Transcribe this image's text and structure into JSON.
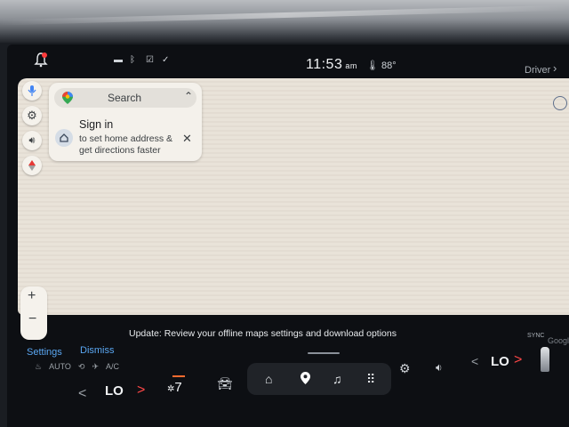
{
  "status_bar": {
    "time": "11:53",
    "ampm": "am",
    "temperature": "88",
    "temp_unit": "°",
    "driver_label": "Driver",
    "icons": [
      "notification-bell-icon",
      "message-icon",
      "bluetooth-icon",
      "checkbox-icon",
      "check-circle-icon"
    ]
  },
  "map": {
    "search_label": "Search",
    "signin_title": "Sign in",
    "signin_subtitle": "to set home address & get directions faster",
    "zoom_in": "+",
    "zoom_out": "−",
    "attribution": "Google",
    "side_buttons": [
      "mic-icon",
      "settings-icon",
      "volume-icon",
      "compass-icon"
    ]
  },
  "notification": {
    "settings_label": "Settings",
    "dismiss_label": "Dismiss",
    "message": "Update: Review your offline maps settings and download options",
    "sync_label": "SYNC"
  },
  "climate": {
    "auto_label": "AUTO",
    "ac_label": "A/C",
    "left_temp": "LO",
    "fan_speed": "7",
    "right_temp": "LO"
  },
  "dock": {
    "icons": [
      "home-icon",
      "map-pin-icon",
      "music-icon",
      "apps-grid-icon"
    ]
  },
  "colors": {
    "accent_link": "#5aa7f2",
    "arrow_red": "#ff4747",
    "fan_orange": "#ff6b2e",
    "map_bg": "#e9e3d9"
  }
}
